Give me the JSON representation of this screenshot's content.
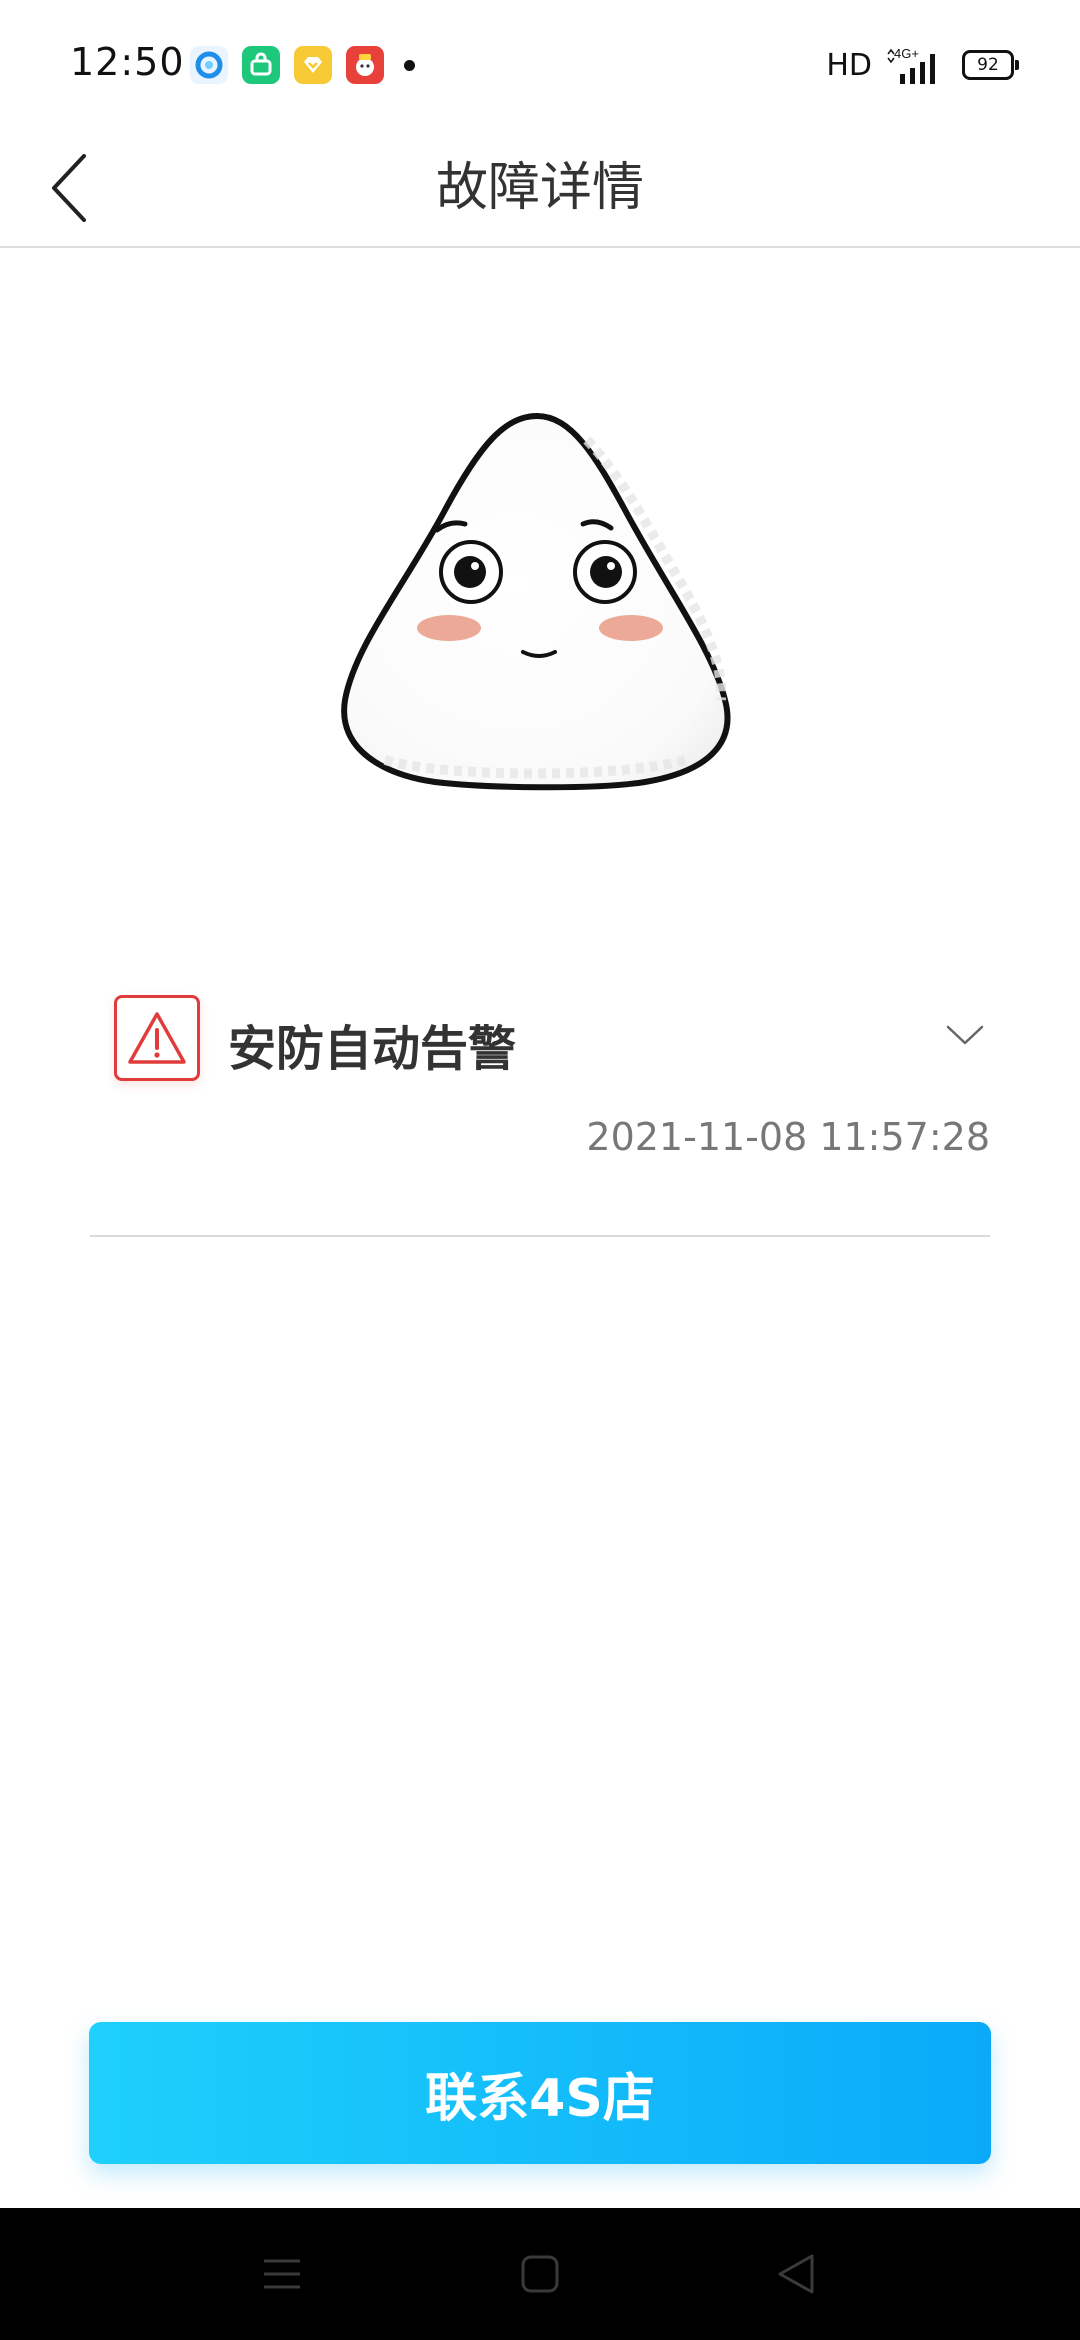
{
  "status_bar": {
    "time": "12:50",
    "network": "HD",
    "signal": "4G+",
    "battery": "92",
    "app_icons": [
      "browser-icon",
      "app-store-icon",
      "wallet-icon",
      "shopping-icon"
    ]
  },
  "header": {
    "title": "故障详情",
    "back_icon": "chevron-left-icon"
  },
  "fault": {
    "icon": "warning-icon",
    "title": "安防自动告警",
    "time": "2021-11-08 11:57:28",
    "expand_icon": "chevron-down-icon",
    "icon_color": "#e03c3c"
  },
  "actions": {
    "contact_label": "联系4S店"
  },
  "colors": {
    "accent_start": "#1ed0fb",
    "accent_end": "#0aaaf9",
    "warning": "#e03c3c"
  },
  "system_nav": {
    "icons": [
      "menu-icon",
      "home-icon",
      "back-triangle-icon"
    ]
  }
}
